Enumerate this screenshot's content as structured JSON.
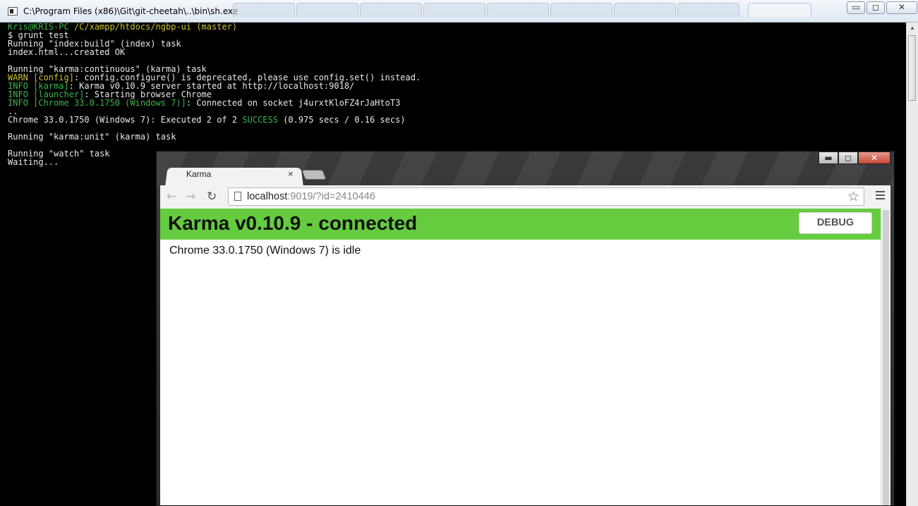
{
  "console": {
    "title": "C:\\Program Files (x86)\\Git\\git-cheetah\\..\\bin\\sh.exe",
    "minimize_label": "▭",
    "maximize_label": "◻",
    "close_label": "✕"
  },
  "terminal": {
    "prompt_user": "Kris@KRIS-PC",
    "prompt_path": "/C/xampp/htdocs/ngbp-ui (master)",
    "cmd": "$ grunt test",
    "line_index_task": "Running \"index:build\" (index) task",
    "line_index_ok": "index.html...created OK",
    "line_karma_cont": "Running \"karma:continuous\" (karma) task",
    "warn_tag": "WARN [config]",
    "warn_msg": ": config.configure() is deprecated, please use config.set() instead.",
    "info_karma_tag": "INFO [karma]",
    "info_karma_msg": ": Karma v0.10.9 server started at http://localhost:9018/",
    "info_launcher_tag": "INFO [launcher]",
    "info_launcher_msg": ": Starting browser Chrome",
    "info_chrome_tag": "INFO [Chrome 33.0.1750 (Windows 7)]",
    "info_chrome_msg": ": Connected on socket j4urxtKloFZ4rJaHtoT3",
    "dots": "..",
    "exec_prefix": "Chrome 33.0.1750 (Windows 7): Executed 2 of 2 ",
    "exec_success": "SUCCESS",
    "exec_suffix": " (0.975 secs / 0.16 secs)",
    "line_karma_unit": "Running \"karma:unit\" (karma) task",
    "line_watch": "Running \"watch\" task",
    "line_waiting": "Waiting..."
  },
  "browser": {
    "tab_title": "Karma",
    "tab_close": "×",
    "back_icon": "←",
    "forward_icon": "→",
    "reload_icon": "↻",
    "star_icon": "☆",
    "url_host": "localhost",
    "url_rest": ":9019/?id=2410446",
    "minimize_label": "▬",
    "maximize_label": "◻",
    "close_label": "✕"
  },
  "karma": {
    "banner_title": "Karma v0.10.9 - connected",
    "debug_label": "DEBUG",
    "status": "Chrome 33.0.1750 (Windows 7) is idle"
  },
  "colors": {
    "banner_green": "#65cc40",
    "terminal_green": "#3cb44a",
    "terminal_yellow": "#c8c030"
  }
}
